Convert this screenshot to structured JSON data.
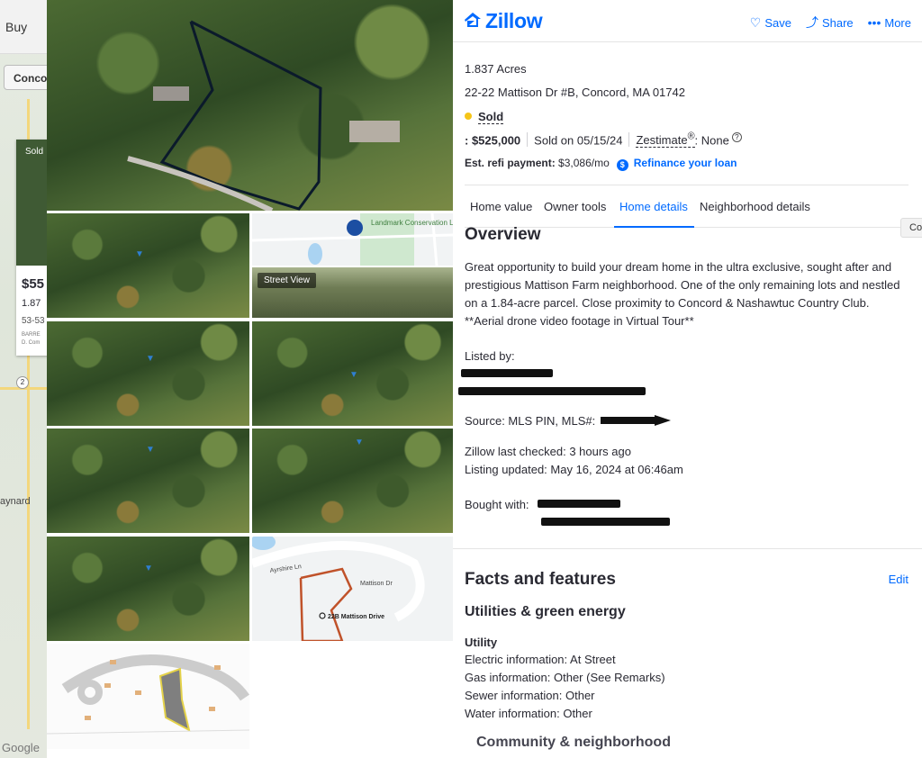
{
  "background": {
    "buy_label": "Buy",
    "location_chip": "Concord",
    "card_sold": "Sold",
    "card_price": "$55",
    "card_acres": "1.87",
    "card_address": "53-53",
    "card_broker_line1": "BARRE",
    "card_broker_line2": "D. Com",
    "town_label": "aynard",
    "google_label": "Google",
    "route_marker": "2"
  },
  "header": {
    "logo": "Zillow",
    "actions": [
      {
        "label": "Save",
        "icon": "heart-icon"
      },
      {
        "label": "Share",
        "icon": "share-icon"
      },
      {
        "label": "More",
        "icon": "more-icon"
      }
    ]
  },
  "gallery": {
    "street_view_label": "Street View",
    "map_place_label": "Landmark Conservation Land",
    "map_road_label_1": "Ayrshire Ln",
    "map_road_label_2": "Mattison Dr",
    "map_address_label": "22B Mattison Drive"
  },
  "listing": {
    "acres": "1.837 Acres",
    "address": "22-22 Mattison Dr #B, Concord, MA 01742",
    "status": "Sold",
    "price": ": $525,000",
    "sold_on": "Sold on 05/15/24",
    "zestimate_label": "Zestimate",
    "zestimate_sup": "®",
    "zestimate_value": ": None",
    "refi_label": "Est. refi payment:",
    "refi_value": "$3,086/mo",
    "refi_link": "Refinance your loan"
  },
  "tabs": [
    "Home value",
    "Owner tools",
    "Home details",
    "Neighborhood details"
  ],
  "active_tab": "Home details",
  "compare_button": "Co",
  "overview": {
    "heading": "Overview",
    "description": "Great opportunity to build your dream home in the ultra exclusive, sought after and prestigious Mattison Farm neighborhood. One of the only remaining lots and nestled on a 1.84-acre parcel. Close proximity to Concord & Nashawtuc Country Club. **Aerial drone video footage in Virtual Tour**",
    "listed_by_label": "Listed by:",
    "source": "Source: MLS PIN,  MLS#:",
    "last_checked": "Zillow last checked: 3 hours ago",
    "listing_updated": "Listing updated: May 16, 2024 at 06:46am",
    "bought_with_label": "Bought with:"
  },
  "facts": {
    "heading": "Facts and features",
    "edit_label": "Edit",
    "utilities_heading": "Utilities & green energy",
    "utility_subheading": "Utility",
    "items": [
      "Electric information: At Street",
      "Gas information: Other (See Remarks)",
      "Sewer information: Other",
      "Water information: Other"
    ],
    "community_heading": "Community & neighborhood"
  },
  "colors": {
    "brand": "#006aff",
    "sold_dot": "#f5c518",
    "text": "#2a2a33"
  }
}
